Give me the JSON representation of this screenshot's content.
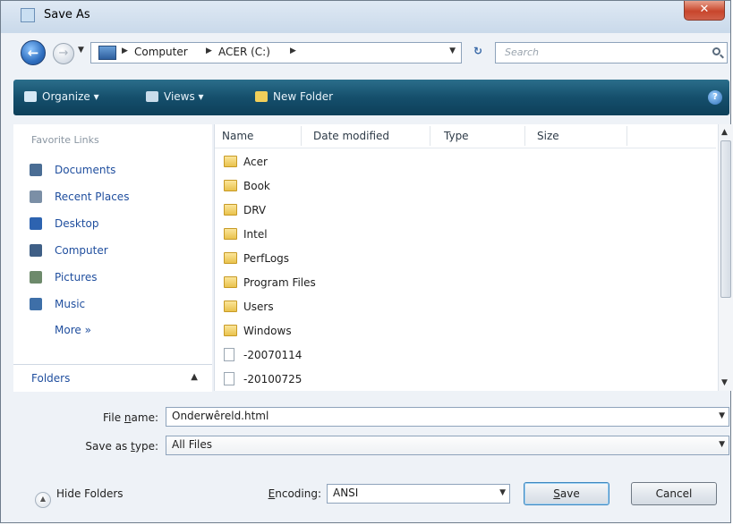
{
  "window": {
    "title": "Save As",
    "close_glyph": "✕"
  },
  "address": {
    "breadcrumbs": [
      "Computer",
      "ACER (C:)"
    ],
    "search_placeholder": "Search"
  },
  "toolbar": {
    "organize": "Organize",
    "views": "Views",
    "new_folder": "New Folder"
  },
  "sidebar": {
    "favorite_links_title": "Favorite Links",
    "items": [
      {
        "label": "Documents",
        "icon": "documents-icon",
        "color": "#4a6d94"
      },
      {
        "label": "Recent Places",
        "icon": "recent-places-icon",
        "color": "#7b8fa6"
      },
      {
        "label": "Desktop",
        "icon": "desktop-icon",
        "color": "#2d63b0"
      },
      {
        "label": "Computer",
        "icon": "computer-icon",
        "color": "#3f5f86"
      },
      {
        "label": "Pictures",
        "icon": "pictures-icon",
        "color": "#6d8a6b"
      },
      {
        "label": "Music",
        "icon": "music-icon",
        "color": "#3e6fa8"
      }
    ],
    "more_label": "More",
    "folders_label": "Folders"
  },
  "filelist": {
    "columns": [
      "Name",
      "Date modified",
      "Type",
      "Size"
    ],
    "rows": [
      {
        "name": "Acer",
        "kind": "folder"
      },
      {
        "name": "Book",
        "kind": "folder"
      },
      {
        "name": "DRV",
        "kind": "folder"
      },
      {
        "name": "Intel",
        "kind": "folder"
      },
      {
        "name": "PerfLogs",
        "kind": "folder"
      },
      {
        "name": "Program Files",
        "kind": "folder"
      },
      {
        "name": "Users",
        "kind": "folder"
      },
      {
        "name": "Windows",
        "kind": "folder"
      },
      {
        "name": "-20070114",
        "kind": "file"
      },
      {
        "name": "-20100725",
        "kind": "file"
      }
    ]
  },
  "form": {
    "file_name_label_pre": "File ",
    "file_name_label_u": "n",
    "file_name_label_post": "ame:",
    "file_name_value": "Onderwêreld.html",
    "save_type_label_pre": "Save as ",
    "save_type_label_u": "t",
    "save_type_label_post": "ype:",
    "save_type_value": "All Files"
  },
  "bottom": {
    "hide_folders": "Hide Folders",
    "encoding_label_u": "E",
    "encoding_label_post": "ncoding:",
    "encoding_value": "ANSI",
    "save_u": "S",
    "save_post": "ave",
    "cancel": "Cancel"
  },
  "colors": {
    "toolbar": "#154f6c",
    "link": "#1f4e9e",
    "close": "#c8462c"
  }
}
